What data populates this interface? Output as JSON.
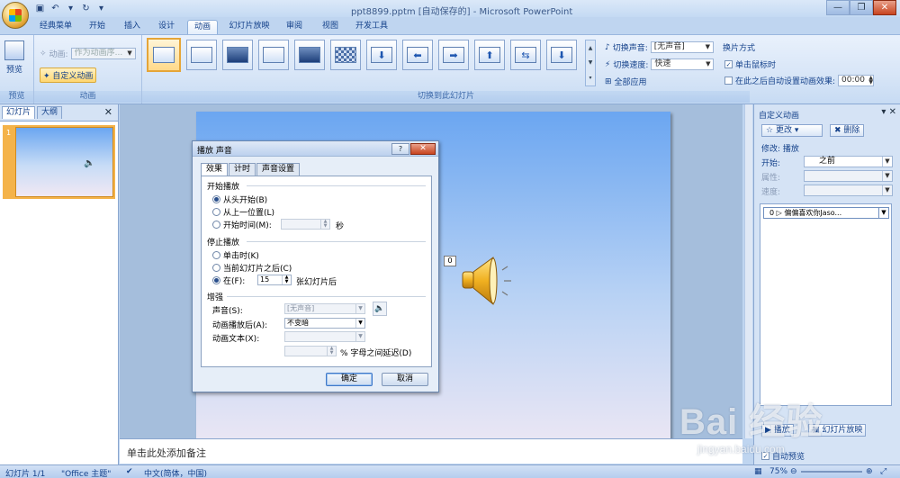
{
  "window": {
    "title": "ppt8899.pptm [自动保存的] - Microsoft PowerPoint"
  },
  "ribbon_tabs": [
    {
      "label": "经典菜单",
      "active": false
    },
    {
      "label": "开始",
      "active": false
    },
    {
      "label": "插入",
      "active": false
    },
    {
      "label": "设计",
      "active": false
    },
    {
      "label": "动画",
      "active": true
    },
    {
      "label": "幻灯片放映",
      "active": false
    },
    {
      "label": "审阅",
      "active": false
    },
    {
      "label": "视图",
      "active": false
    },
    {
      "label": "开发工具",
      "active": false
    }
  ],
  "ribbon": {
    "preview_group": {
      "label": "预览",
      "button": "预览"
    },
    "animation_group": {
      "label": "动画",
      "animation_label": "动画:",
      "animation_value": "作为动画序...",
      "custom_anim_button": "自定义动画"
    },
    "transition_group": {
      "label": "切换到此幻灯片",
      "sound_label": "切换声音:",
      "sound_value": "[无声音]",
      "speed_label": "切换速度:",
      "speed_value": "快速",
      "apply_all": "全部应用"
    },
    "advance_group": {
      "title": "换片方式",
      "on_click": "单击鼠标时",
      "on_click_checked": true,
      "after_time": "在此之后自动设置动画效果:",
      "after_time_checked": false,
      "time_value": "00:00"
    }
  },
  "left_pane": {
    "tabs": [
      "幻灯片",
      "大纲"
    ],
    "slide_number": "1"
  },
  "slide": {
    "anim_tag": "0"
  },
  "notes": {
    "placeholder": "单击此处添加备注"
  },
  "dialog": {
    "title": "播放 声音",
    "help": "?",
    "tabs": [
      "效果",
      "计时",
      "声音设置"
    ],
    "start_section": "开始播放",
    "start_options": [
      "从头开始(B)",
      "从上一位置(L)",
      "开始时间(M):"
    ],
    "start_selected": 0,
    "start_time_unit": "秒",
    "stop_section": "停止播放",
    "stop_options": [
      "单击时(K)",
      "当前幻灯片之后(C)",
      "在(F):"
    ],
    "stop_selected": 2,
    "stop_after_value": "15",
    "stop_after_unit": "张幻灯片后",
    "enhance_section": "增强",
    "sound_label": "声音(S):",
    "sound_value": "[无声音]",
    "after_anim_label": "动画播放后(A):",
    "after_anim_value": "不变暗",
    "anim_text_label": "动画文本(X):",
    "letter_delay": "% 字母之间延迟(D)",
    "ok": "确定",
    "cancel": "取消"
  },
  "right_pane": {
    "title": "自定义动画",
    "change_button": "更改",
    "remove_button": "删除",
    "modify_label": "修改: 播放",
    "start_label": "开始:",
    "start_value": "之前",
    "property_label": "属性:",
    "speed_label": "速度:",
    "list_item": "0     ▷ 偏偏喜欢你Jaso...",
    "play_button": "播放",
    "slideshow_button": "幻灯片放映",
    "autopreview": "自动预览",
    "autopreview_checked": true
  },
  "statusbar": {
    "slide": "幻灯片 1/1",
    "theme": "\"Office 主题\"",
    "language": "中文(简体，中国)",
    "zoom": "75%"
  },
  "watermark": {
    "brand": "Bai  经验",
    "url": "jingyan.baidu.com"
  }
}
